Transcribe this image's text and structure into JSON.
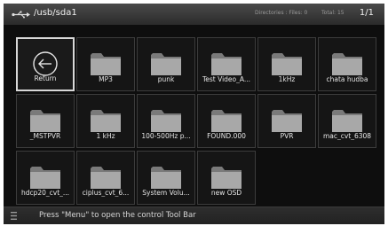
{
  "header": {
    "path": "/usb/sda1",
    "directories_label": "Directories : Files: 0",
    "total_label": "Total: 15",
    "page_indicator": "1/1",
    "usb_icon": "usb-icon"
  },
  "grid": {
    "items": [
      {
        "label": "Return",
        "icon": "return-icon",
        "selected": true
      },
      {
        "label": "MP3",
        "icon": "folder-icon"
      },
      {
        "label": "punk",
        "icon": "folder-icon"
      },
      {
        "label": "Test Video_A...",
        "icon": "folder-icon"
      },
      {
        "label": "1kHz",
        "icon": "folder-icon"
      },
      {
        "label": "chata hudba",
        "icon": "folder-icon"
      },
      {
        "label": "_MSTPVR",
        "icon": "folder-icon"
      },
      {
        "label": "1 kHz",
        "icon": "folder-icon"
      },
      {
        "label": "100-500Hz p...",
        "icon": "folder-icon"
      },
      {
        "label": "FOUND.000",
        "icon": "folder-icon"
      },
      {
        "label": "PVR",
        "icon": "folder-icon"
      },
      {
        "label": "mac_cvt_6308",
        "icon": "folder-icon"
      },
      {
        "label": "hdcp20_cvt_...",
        "icon": "folder-icon"
      },
      {
        "label": "ciplus_cvt_6...",
        "icon": "folder-icon"
      },
      {
        "label": "System Volu...",
        "icon": "folder-icon"
      },
      {
        "label": "new OSD",
        "icon": "folder-icon"
      }
    ]
  },
  "footer": {
    "hint": "Press \"Menu\" to open the control Tool Bar",
    "menu_icon": "menu-icon"
  },
  "colors": {
    "background": "#0e0e0e",
    "tile_border": "#3c3c3c",
    "selected_border": "#d8d8d8",
    "folder": "#a8a8a8"
  }
}
